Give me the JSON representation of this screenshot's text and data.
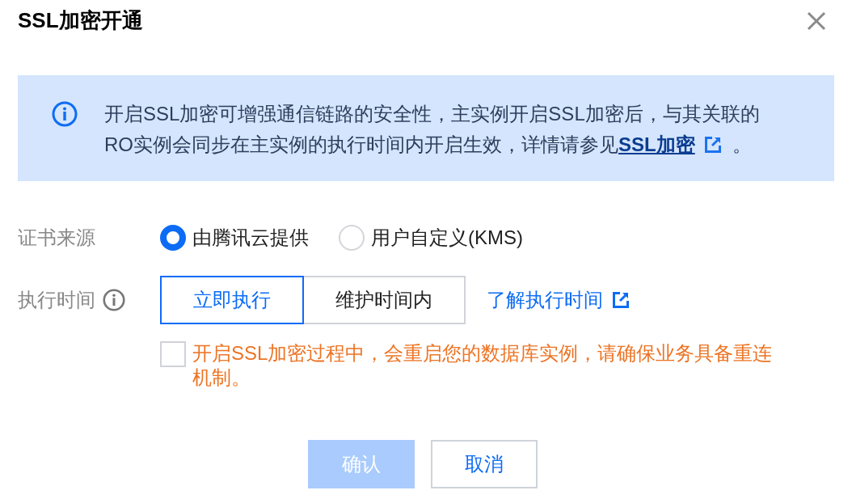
{
  "dialog": {
    "title": "SSL加密开通"
  },
  "alert": {
    "text": "开启SSL加密可增强通信链路的安全性，主实例开启SSL加密后，与其关联的RO实例会同步在主实例的执行时间内开启生效，详情请参见",
    "link": "SSL加密",
    "text_after": "。"
  },
  "certificate_source": {
    "label": "证书来源",
    "options": [
      {
        "label": "由腾讯云提供",
        "selected": true
      },
      {
        "label": "用户自定义(KMS)",
        "selected": false
      }
    ]
  },
  "execution_time": {
    "label": "执行时间",
    "options": [
      {
        "label": "立即执行",
        "selected": true
      },
      {
        "label": "维护时间内",
        "selected": false
      }
    ],
    "link": "了解执行时间"
  },
  "confirmation": {
    "text": "开启SSL加密过程中，会重启您的数据库实例，请确保业务具备重连机制。",
    "checked": false
  },
  "buttons": [
    {
      "label": "确认",
      "kind": "primary",
      "disabled": true
    },
    {
      "label": "取消",
      "kind": "default",
      "disabled": false
    }
  ]
}
